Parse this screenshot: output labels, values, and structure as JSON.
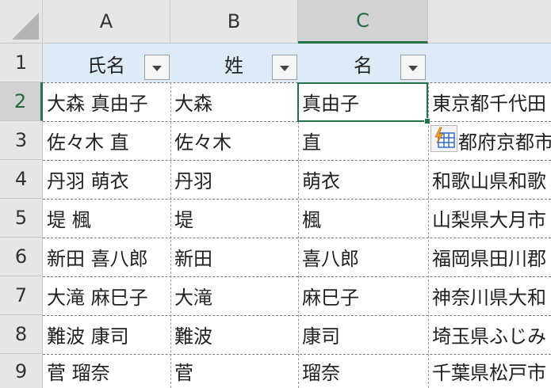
{
  "columns": [
    {
      "label": "A",
      "selected": false
    },
    {
      "label": "B",
      "selected": false
    },
    {
      "label": "C",
      "selected": true
    }
  ],
  "rows": [
    {
      "num": "1"
    },
    {
      "num": "2"
    },
    {
      "num": "3"
    },
    {
      "num": "4"
    },
    {
      "num": "5"
    },
    {
      "num": "6"
    },
    {
      "num": "7"
    },
    {
      "num": "8"
    },
    {
      "num": "9"
    }
  ],
  "header": {
    "a": "氏名",
    "b": "姓",
    "c": "名"
  },
  "data": [
    {
      "a": "大森 真由子",
      "b": "大森",
      "c": "真由子",
      "d": "東京都千代田"
    },
    {
      "a": "佐々木 直",
      "b": "佐々木",
      "c": "直",
      "d": "都府京都市"
    },
    {
      "a": "丹羽 萌衣",
      "b": "丹羽",
      "c": "萌衣",
      "d": "和歌山県和歌"
    },
    {
      "a": "堤 楓",
      "b": "堤",
      "c": "楓",
      "d": "山梨県大月市"
    },
    {
      "a": "新田 喜八郎",
      "b": "新田",
      "c": "喜八郎",
      "d": "福岡県田川郡"
    },
    {
      "a": "大滝 麻巳子",
      "b": "大滝",
      "c": "麻巳子",
      "d": "神奈川県大和"
    },
    {
      "a": "難波 康司",
      "b": "難波",
      "c": "康司",
      "d": "埼玉県ふじみ"
    },
    {
      "a": "菅 瑠奈",
      "b": "菅",
      "c": "瑠奈",
      "d": "千葉県松戸市"
    }
  ],
  "colors": {
    "accent": "#217346",
    "header_fill": "#ddebf7",
    "flash_fill_bolt": "#f0a030",
    "flash_fill_grid": "#2f6fd0"
  },
  "icons": {
    "corner": "select-all-triangle",
    "filter": "dropdown-arrow",
    "flash": "flash-fill-icon"
  }
}
